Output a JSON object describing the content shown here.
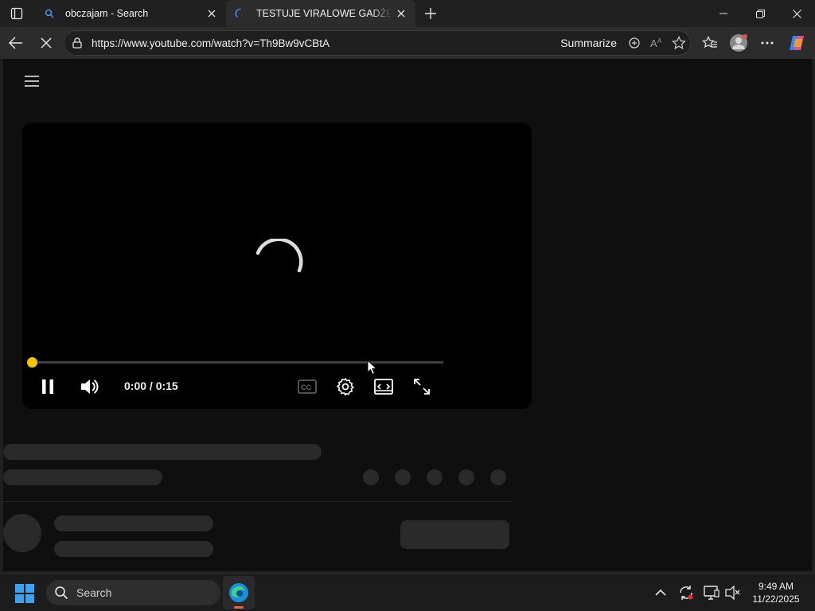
{
  "tabs": [
    {
      "title": "obczajam - Search",
      "favicon": "search-favicon"
    },
    {
      "title": "TESTUJE VIRALOWE GADŻETY DO",
      "favicon": "loading-favicon"
    }
  ],
  "toolbar": {
    "url": "https://www.youtube.com/watch?v=Th9Bw9vCBtA",
    "summarize_label": "Summarize"
  },
  "player": {
    "time": "0:00 / 0:15",
    "progress": 0.0,
    "accent": "#f5c400",
    "state": "loading"
  },
  "taskbar": {
    "search_placeholder": "Search",
    "time": "9:49 AM",
    "date": "11/22/2025"
  }
}
